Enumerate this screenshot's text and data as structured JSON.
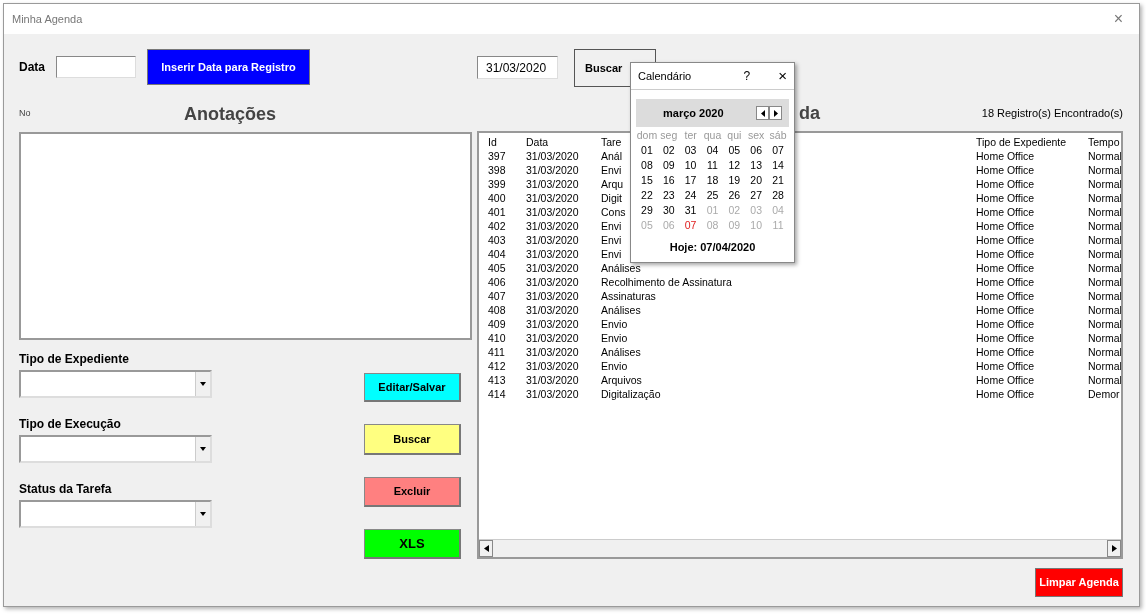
{
  "window": {
    "title": "Minha Agenda",
    "close": "×"
  },
  "left": {
    "date_label": "Data",
    "insert_button": "Inserir Data para Registro",
    "no_label": "No",
    "notes_title": "Anotações",
    "combos": [
      {
        "label": "Tipo de Expediente"
      },
      {
        "label": "Tipo de Execução"
      },
      {
        "label": "Status da Tarefa"
      }
    ],
    "buttons": [
      {
        "label": "Editar/Salvar",
        "color": "#00ffff"
      },
      {
        "label": "Buscar",
        "color": "#ffff80"
      },
      {
        "label": "Excluir",
        "color": "#ff8080"
      },
      {
        "label": "XLS",
        "color": "#00ff00"
      }
    ]
  },
  "right": {
    "search_date": "31/03/2020",
    "search_button": "Buscar",
    "table_title": "da",
    "count": "18 Registro(s) Encontrado(s)",
    "table": {
      "columns": [
        "Id",
        "Data",
        "Tare",
        "Tipo de Expediente",
        "Tempo"
      ],
      "rows": [
        [
          "397",
          "31/03/2020",
          "Anál",
          "Home Office",
          "Normal"
        ],
        [
          "398",
          "31/03/2020",
          "Envi",
          "Home Office",
          "Normal"
        ],
        [
          "399",
          "31/03/2020",
          "Arqu",
          "Home Office",
          "Normal"
        ],
        [
          "400",
          "31/03/2020",
          "Digit",
          "Home Office",
          "Normal"
        ],
        [
          "401",
          "31/03/2020",
          "Cons",
          "Home Office",
          "Normal"
        ],
        [
          "402",
          "31/03/2020",
          "Envi",
          "Home Office",
          "Normal"
        ],
        [
          "403",
          "31/03/2020",
          "Envi",
          "Home Office",
          "Normal"
        ],
        [
          "404",
          "31/03/2020",
          "Envi",
          "Home Office",
          "Normal"
        ],
        [
          "405",
          "31/03/2020",
          "Análises",
          "Home Office",
          "Normal"
        ],
        [
          "406",
          "31/03/2020",
          "Recolhimento de Assinatura",
          "Home Office",
          "Normal"
        ],
        [
          "407",
          "31/03/2020",
          "Assinaturas",
          "Home Office",
          "Normal"
        ],
        [
          "408",
          "31/03/2020",
          "Análises",
          "Home Office",
          "Normal"
        ],
        [
          "409",
          "31/03/2020",
          "Envio",
          "Home Office",
          "Normal"
        ],
        [
          "410",
          "31/03/2020",
          "Envio",
          "Home Office",
          "Normal"
        ],
        [
          "411",
          "31/03/2020",
          "Análises",
          "Home Office",
          "Normal"
        ],
        [
          "412",
          "31/03/2020",
          "Envio",
          "Home Office",
          "Normal"
        ],
        [
          "413",
          "31/03/2020",
          "Arquivos",
          "Home Office",
          "Normal"
        ],
        [
          "414",
          "31/03/2020",
          "Digitalização",
          "Home Office",
          "Demor"
        ]
      ]
    },
    "clear_button": "Limpar Agenda"
  },
  "calendar": {
    "title": "Calendário",
    "help": "?",
    "close": "×",
    "month": "março 2020",
    "weekdays": [
      "dom",
      "seg",
      "ter",
      "qua",
      "qui",
      "sex",
      "sáb"
    ],
    "days": [
      {
        "label": "01",
        "in_month": true,
        "today": false
      },
      {
        "label": "02",
        "in_month": true,
        "today": false
      },
      {
        "label": "03",
        "in_month": true,
        "today": false
      },
      {
        "label": "04",
        "in_month": true,
        "today": false
      },
      {
        "label": "05",
        "in_month": true,
        "today": false
      },
      {
        "label": "06",
        "in_month": true,
        "today": false
      },
      {
        "label": "07",
        "in_month": true,
        "today": false
      },
      {
        "label": "08",
        "in_month": true,
        "today": false
      },
      {
        "label": "09",
        "in_month": true,
        "today": false
      },
      {
        "label": "10",
        "in_month": true,
        "today": false
      },
      {
        "label": "11",
        "in_month": true,
        "today": false
      },
      {
        "label": "12",
        "in_month": true,
        "today": false
      },
      {
        "label": "13",
        "in_month": true,
        "today": false
      },
      {
        "label": "14",
        "in_month": true,
        "today": false
      },
      {
        "label": "15",
        "in_month": true,
        "today": false
      },
      {
        "label": "16",
        "in_month": true,
        "today": false
      },
      {
        "label": "17",
        "in_month": true,
        "today": false
      },
      {
        "label": "18",
        "in_month": true,
        "today": false
      },
      {
        "label": "19",
        "in_month": true,
        "today": false
      },
      {
        "label": "20",
        "in_month": true,
        "today": false
      },
      {
        "label": "21",
        "in_month": true,
        "today": false
      },
      {
        "label": "22",
        "in_month": true,
        "today": false
      },
      {
        "label": "23",
        "in_month": true,
        "today": false
      },
      {
        "label": "24",
        "in_month": true,
        "today": false
      },
      {
        "label": "25",
        "in_month": true,
        "today": false
      },
      {
        "label": "26",
        "in_month": true,
        "today": false
      },
      {
        "label": "27",
        "in_month": true,
        "today": false
      },
      {
        "label": "28",
        "in_month": true,
        "today": false
      },
      {
        "label": "29",
        "in_month": true,
        "today": false
      },
      {
        "label": "30",
        "in_month": true,
        "today": false
      },
      {
        "label": "31",
        "in_month": true,
        "today": false
      },
      {
        "label": "01",
        "in_month": false,
        "today": false
      },
      {
        "label": "02",
        "in_month": false,
        "today": false
      },
      {
        "label": "03",
        "in_month": false,
        "today": false
      },
      {
        "label": "04",
        "in_month": false,
        "today": false
      },
      {
        "label": "05",
        "in_month": false,
        "today": false
      },
      {
        "label": "06",
        "in_month": false,
        "today": false
      },
      {
        "label": "07",
        "in_month": false,
        "today": true
      },
      {
        "label": "08",
        "in_month": false,
        "today": false
      },
      {
        "label": "09",
        "in_month": false,
        "today": false
      },
      {
        "label": "10",
        "in_month": false,
        "today": false
      },
      {
        "label": "11",
        "in_month": false,
        "today": false
      }
    ],
    "today_label": "Hoje: 07/04/2020"
  }
}
